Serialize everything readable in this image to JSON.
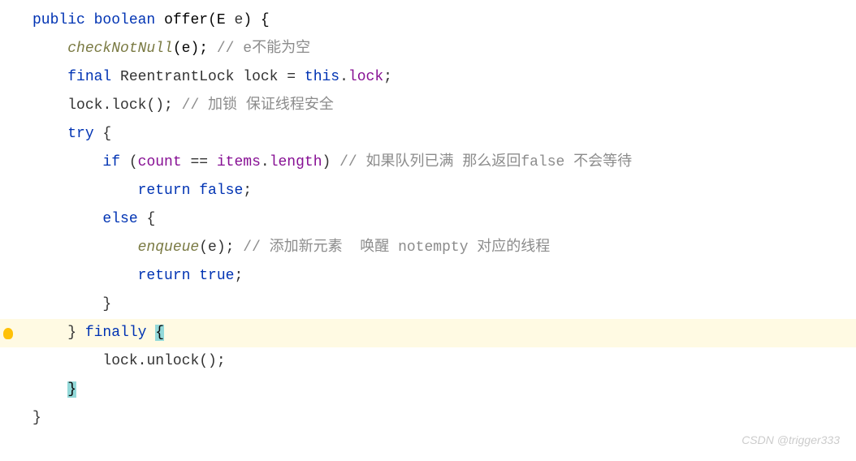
{
  "code": {
    "l1": {
      "kw_public": "public",
      "kw_boolean": "boolean",
      "method_name": "offer",
      "paren_open": "(",
      "param_type": "E",
      "param_name": " e",
      "paren_close": ")",
      "brace": " {"
    },
    "l2": {
      "indent": "    ",
      "method": "checkNotNull",
      "args": "(e); ",
      "comment": "// e不能为空"
    },
    "l3": {
      "indent": "    ",
      "kw_final": "final",
      "type": " ReentrantLock ",
      "var": "lock",
      "eq": " = ",
      "kw_this": "this",
      "dot": ".",
      "field": "lock",
      "semi": ";"
    },
    "l4": {
      "indent": "    ",
      "obj": "lock",
      "call": ".lock(); ",
      "comment": "// 加锁 保证线程安全"
    },
    "l5": {
      "indent": "    ",
      "kw_try": "try",
      "brace": " {"
    },
    "l6": {
      "indent": "        ",
      "kw_if": "if",
      "paren_open": " (",
      "field1": "count",
      "op": " == ",
      "field2": "items",
      "dot": ".",
      "prop": "length",
      "paren_close": ") ",
      "comment": "// 如果队列已满 那么返回false 不会等待"
    },
    "l7": {
      "indent": "            ",
      "kw_return": "return",
      "kw_false": " false",
      "semi": ";"
    },
    "l8": {
      "indent": "        ",
      "kw_else": "else",
      "brace": " {"
    },
    "l9": {
      "indent": "            ",
      "method": "enqueue",
      "args": "(e); ",
      "comment": "// 添加新元素  唤醒 notempty 对应的线程"
    },
    "l10": {
      "indent": "            ",
      "kw_return": "return",
      "kw_true": " true",
      "semi": ";"
    },
    "l11": {
      "indent": "        ",
      "brace": "}"
    },
    "l12": {
      "indent": "    ",
      "brace_close": "} ",
      "kw_finally": "finally",
      "space": " ",
      "brace_open": "{"
    },
    "l13": {
      "indent": "        ",
      "obj": "lock",
      "call": ".unlock();"
    },
    "l14": {
      "indent": "    ",
      "brace": "}"
    },
    "l15": {
      "brace": "}"
    }
  },
  "watermark": "CSDN @trigger333"
}
